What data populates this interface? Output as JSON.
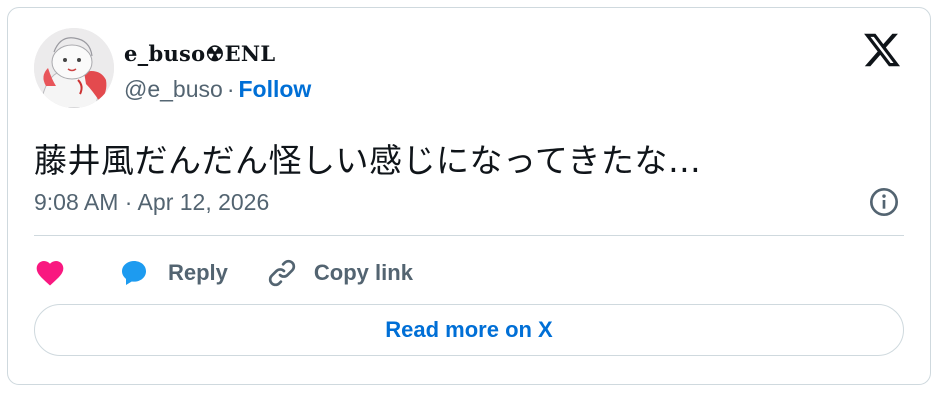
{
  "author": {
    "display_name": "e_buso☢ENL",
    "handle": "@e_buso",
    "separator": "·",
    "follow_label": "Follow",
    "avatar_icon": "avatar-drawing"
  },
  "tweet": {
    "text": "藤井風だんだん怪しい感じになってきたな…",
    "timestamp": "9:08 AM · Apr 12, 2026"
  },
  "actions": {
    "like_icon": "heart-icon",
    "reply_label": "Reply",
    "copy_label": "Copy link"
  },
  "footer": {
    "read_more_label": "Read more on X"
  },
  "colors": {
    "accent": "#006fd6",
    "like": "#f91880",
    "reply": "#1d9bf0",
    "muted": "#536471",
    "border": "#cfd9de"
  }
}
